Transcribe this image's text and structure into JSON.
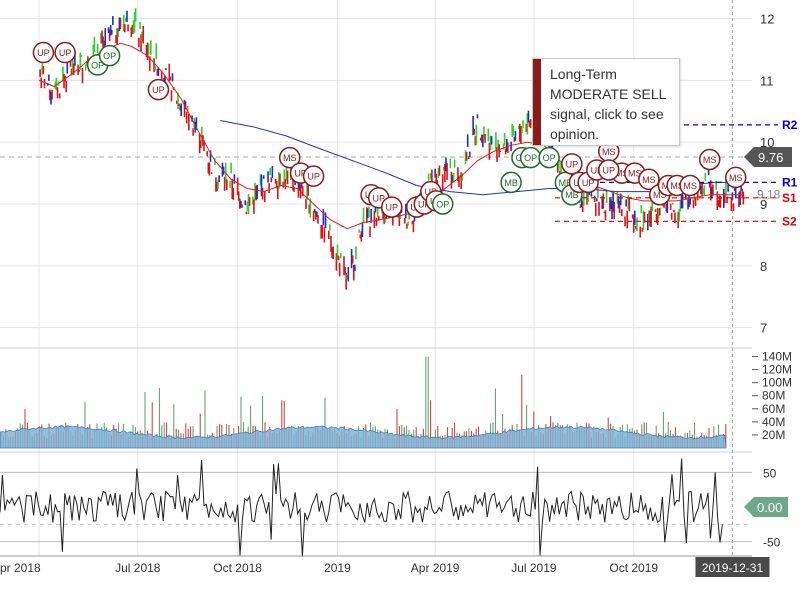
{
  "tooltip": {
    "text": "Long-Term MODERATE SELL signal, click to see opinion."
  },
  "colors": {
    "up": "#33cc33",
    "down": "#dd1111",
    "neutral": "#1133cc",
    "sma_short": "#e02020",
    "sma_long": "#2233bb",
    "volume_area": "#7aaed6",
    "support": "#dd0000",
    "resistance": "#0000dd",
    "marker_red": "#8b1a1a",
    "marker_green": "#1f6b2a",
    "badge": "#555555",
    "osc_badge": "#6fa888"
  },
  "chart_data": [
    {
      "type": "line",
      "panel": "price",
      "description_free": true,
      "x_tick_labels": [
        "pr 2018",
        "Jul 2018",
        "Oct 2018",
        "2019",
        "Apr 2019",
        "Jul 2019",
        "Oct 2019"
      ],
      "y_tick_labels": [
        "7",
        "8",
        "9",
        "10",
        "11",
        "12"
      ],
      "ylim": [
        7,
        12.2
      ],
      "price_series": {
        "x": [
          "2018-04-01",
          "2018-04-15",
          "2018-05-01",
          "2018-05-15",
          "2018-06-01",
          "2018-06-15",
          "2018-06-25",
          "2018-07-10",
          "2018-07-25",
          "2018-08-10",
          "2018-08-25",
          "2018-09-10",
          "2018-09-25",
          "2018-10-10",
          "2018-10-25",
          "2018-11-10",
          "2018-11-25",
          "2018-12-10",
          "2018-12-25",
          "2019-01-10",
          "2019-01-25",
          "2019-02-10",
          "2019-02-25",
          "2019-03-10",
          "2019-03-25",
          "2019-04-10",
          "2019-04-25",
          "2019-05-10",
          "2019-05-25",
          "2019-06-10",
          "2019-06-25",
          "2019-07-10",
          "2019-07-25",
          "2019-08-10",
          "2019-08-25",
          "2019-09-10",
          "2019-09-25",
          "2019-10-10",
          "2019-10-25",
          "2019-11-10",
          "2019-11-25",
          "2019-12-10",
          "2019-12-20",
          "2019-12-31",
          "2020-01-10"
        ],
        "close": [
          11.1,
          10.8,
          11.2,
          11.3,
          11.6,
          11.9,
          12.0,
          11.5,
          11.1,
          10.6,
          10.2,
          9.5,
          9.35,
          8.95,
          9.3,
          9.45,
          9.35,
          8.9,
          8.5,
          7.7,
          8.7,
          8.9,
          8.75,
          8.8,
          9.2,
          9.55,
          9.5,
          10.3,
          9.9,
          9.95,
          10.35,
          10.2,
          9.6,
          9.15,
          9.1,
          8.95,
          8.9,
          8.7,
          9.0,
          8.9,
          9.15,
          9.35,
          9.15,
          9.1,
          9.18
        ]
      },
      "sma_short": [
        11.0,
        10.9,
        11.1,
        11.3,
        11.5,
        11.6,
        11.55,
        11.4,
        11.1,
        10.7,
        10.2,
        9.7,
        9.4,
        9.25,
        9.2,
        9.3,
        9.25,
        9.0,
        8.75,
        8.6,
        8.7,
        8.75,
        8.8,
        8.85,
        9.0,
        9.25,
        9.45,
        9.7,
        9.85,
        9.95,
        10.0,
        9.95,
        9.7,
        9.45,
        9.3,
        9.2,
        9.1,
        9.05,
        9.05,
        9.05,
        9.1,
        9.15,
        9.15,
        9.15,
        9.15
      ],
      "sma_long_x": [
        "2018-09-15",
        "2018-10-15",
        "2018-11-15",
        "2018-12-15",
        "2019-01-15",
        "2019-02-15",
        "2019-03-15",
        "2019-04-15",
        "2019-05-15",
        "2019-06-15",
        "2019-07-15",
        "2019-08-15",
        "2019-09-15",
        "2019-10-15",
        "2019-11-15",
        "2019-12-15",
        "2020-01-10"
      ],
      "sma_long": [
        10.35,
        10.25,
        10.1,
        9.9,
        9.7,
        9.5,
        9.3,
        9.2,
        9.15,
        9.2,
        9.25,
        9.25,
        9.2,
        9.2,
        9.3,
        9.35,
        9.35
      ],
      "last_price": "9.76",
      "last_close": "9.18",
      "levels": [
        {
          "label": "R2",
          "value": 10.28,
          "kind": "resistance"
        },
        {
          "label": "R1",
          "value": 9.35,
          "kind": "resistance"
        },
        {
          "label": "S1",
          "value": 9.1,
          "kind": "support"
        },
        {
          "label": "S2",
          "value": 8.72,
          "kind": "support"
        }
      ],
      "markers": [
        {
          "text": "UP",
          "date": "2018-04-05",
          "price": 11.45,
          "color": "red"
        },
        {
          "text": "UP",
          "date": "2018-04-25",
          "price": 11.45,
          "color": "red"
        },
        {
          "text": "OP",
          "date": "2018-05-25",
          "price": 11.25,
          "color": "green"
        },
        {
          "text": "OP",
          "date": "2018-06-05",
          "price": 11.4,
          "color": "green"
        },
        {
          "text": "UP",
          "date": "2018-07-20",
          "price": 10.85,
          "color": "red"
        },
        {
          "text": "MS",
          "date": "2018-11-18",
          "price": 9.75,
          "color": "red"
        },
        {
          "text": "UP",
          "date": "2018-11-28",
          "price": 9.5,
          "color": "red"
        },
        {
          "text": "UP",
          "date": "2018-12-10",
          "price": 9.45,
          "color": "red"
        },
        {
          "text": "UP",
          "date": "2019-02-01",
          "price": 9.15,
          "color": "red"
        },
        {
          "text": "UP",
          "date": "2019-02-08",
          "price": 9.1,
          "color": "red"
        },
        {
          "text": "UP",
          "date": "2019-02-20",
          "price": 8.95,
          "color": "red"
        },
        {
          "text": "UP",
          "date": "2019-03-15",
          "price": 8.95,
          "color": "red"
        },
        {
          "text": "UP",
          "date": "2019-03-22",
          "price": 9.0,
          "color": "red"
        },
        {
          "text": "UP",
          "date": "2019-03-28",
          "price": 9.2,
          "color": "red"
        },
        {
          "text": "UP",
          "date": "2019-04-02",
          "price": 9.05,
          "color": "red"
        },
        {
          "text": "OP",
          "date": "2019-04-08",
          "price": 9.0,
          "color": "green"
        },
        {
          "text": "MB",
          "date": "2019-06-10",
          "price": 9.35,
          "color": "green"
        },
        {
          "text": "OP",
          "date": "2019-06-20",
          "price": 9.75,
          "color": "green"
        },
        {
          "text": "OP",
          "date": "2019-06-28",
          "price": 9.75,
          "color": "green"
        },
        {
          "text": "OP",
          "date": "2019-07-15",
          "price": 9.75,
          "color": "green"
        },
        {
          "text": "MB",
          "date": "2019-07-30",
          "price": 9.35,
          "color": "green"
        },
        {
          "text": "UP",
          "date": "2019-08-05",
          "price": 9.65,
          "color": "red"
        },
        {
          "text": "MB",
          "date": "2019-08-05",
          "price": 9.15,
          "color": "green"
        },
        {
          "text": "UP",
          "date": "2019-08-12",
          "price": 9.35,
          "color": "red"
        },
        {
          "text": "UP",
          "date": "2019-08-20",
          "price": 9.35,
          "color": "red"
        },
        {
          "text": "UP",
          "date": "2019-08-28",
          "price": 9.55,
          "color": "red"
        },
        {
          "text": "MS",
          "date": "2019-09-08",
          "price": 9.85,
          "color": "red"
        },
        {
          "text": "MS",
          "date": "2019-09-20",
          "price": 9.5,
          "color": "red"
        },
        {
          "text": "UP",
          "date": "2019-09-08",
          "price": 9.55,
          "color": "red"
        },
        {
          "text": "MS",
          "date": "2019-10-02",
          "price": 9.5,
          "color": "red"
        },
        {
          "text": "MS",
          "date": "2019-10-15",
          "price": 9.4,
          "color": "red"
        },
        {
          "text": "MS",
          "date": "2019-10-25",
          "price": 9.15,
          "color": "red"
        },
        {
          "text": "MS",
          "date": "2019-11-02",
          "price": 9.3,
          "color": "red"
        },
        {
          "text": "MS",
          "date": "2019-11-10",
          "price": 9.3,
          "color": "red"
        },
        {
          "text": "MS",
          "date": "2019-11-22",
          "price": 9.3,
          "color": "red"
        },
        {
          "text": "MS",
          "date": "2019-12-10",
          "price": 9.72,
          "color": "red"
        },
        {
          "text": "MS",
          "date": "2020-01-03",
          "price": 9.43,
          "color": "red"
        }
      ]
    },
    {
      "type": "bar",
      "panel": "volume",
      "y_tick_labels": [
        "20M",
        "40M",
        "60M",
        "80M",
        "100M",
        "120M",
        "140M"
      ],
      "ylim": [
        0,
        150
      ]
    },
    {
      "type": "line",
      "panel": "oscillator",
      "y_tick_labels": [
        "50",
        "-50"
      ],
      "ylim": [
        -75,
        75
      ],
      "last_value": "0.00"
    }
  ],
  "x_axis_highlight": "2019-12-31"
}
